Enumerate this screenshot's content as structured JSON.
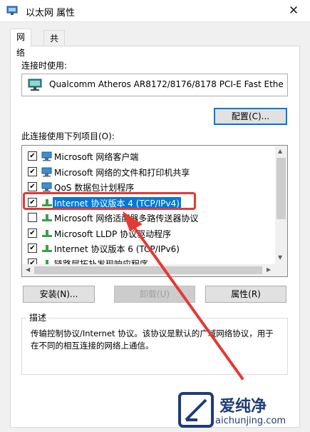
{
  "window": {
    "title": "以太网 属性",
    "close_glyph": "✕"
  },
  "tabs": [
    {
      "label": "网络"
    },
    {
      "label": "共享"
    }
  ],
  "connect_using_label": "连接时使用:",
  "adapter_name": "Qualcomm Atheros AR8172/8176/8178 PCI-E Fast Ethe",
  "configure_button": "配置(C)...",
  "items_label": "此连接使用下列项目(O):",
  "items": [
    {
      "label": "Microsoft 网络客户端",
      "checked": true,
      "icon": "network-client-icon"
    },
    {
      "label": "Microsoft 网络的文件和打印机共享",
      "checked": true,
      "icon": "file-share-icon"
    },
    {
      "label": "QoS 数据包计划程序",
      "checked": true,
      "icon": "qos-icon"
    },
    {
      "label": "Internet 协议版本 4 (TCP/IPv4)",
      "checked": true,
      "icon": "protocol-icon",
      "selected": true
    },
    {
      "label": "Microsoft 网络适配器多路传送器协议",
      "checked": false,
      "icon": "protocol-icon"
    },
    {
      "label": "Microsoft LLDP 协议驱动程序",
      "checked": true,
      "icon": "protocol-icon"
    },
    {
      "label": "Internet 协议版本 6 (TCP/IPv6)",
      "checked": true,
      "icon": "protocol-icon"
    },
    {
      "label": "链路层拓扑发现响应程序",
      "checked": true,
      "icon": "protocol-icon"
    }
  ],
  "buttons": {
    "install": "安装(N)...",
    "uninstall": "卸载(U)",
    "properties": "属性(R)"
  },
  "description": {
    "title": "描述",
    "text": "传输控制协议/Internet 协议。该协议是默认的广域网络协议，用于在不同的相互连接的网络上通信。"
  },
  "watermark": {
    "brand": "爱纯净",
    "url": "aichunjing.com"
  },
  "colors": {
    "selection": "#0078d7",
    "highlight_box": "#e53935",
    "arrow": "#e53935",
    "watermark": "#1e3c78"
  }
}
